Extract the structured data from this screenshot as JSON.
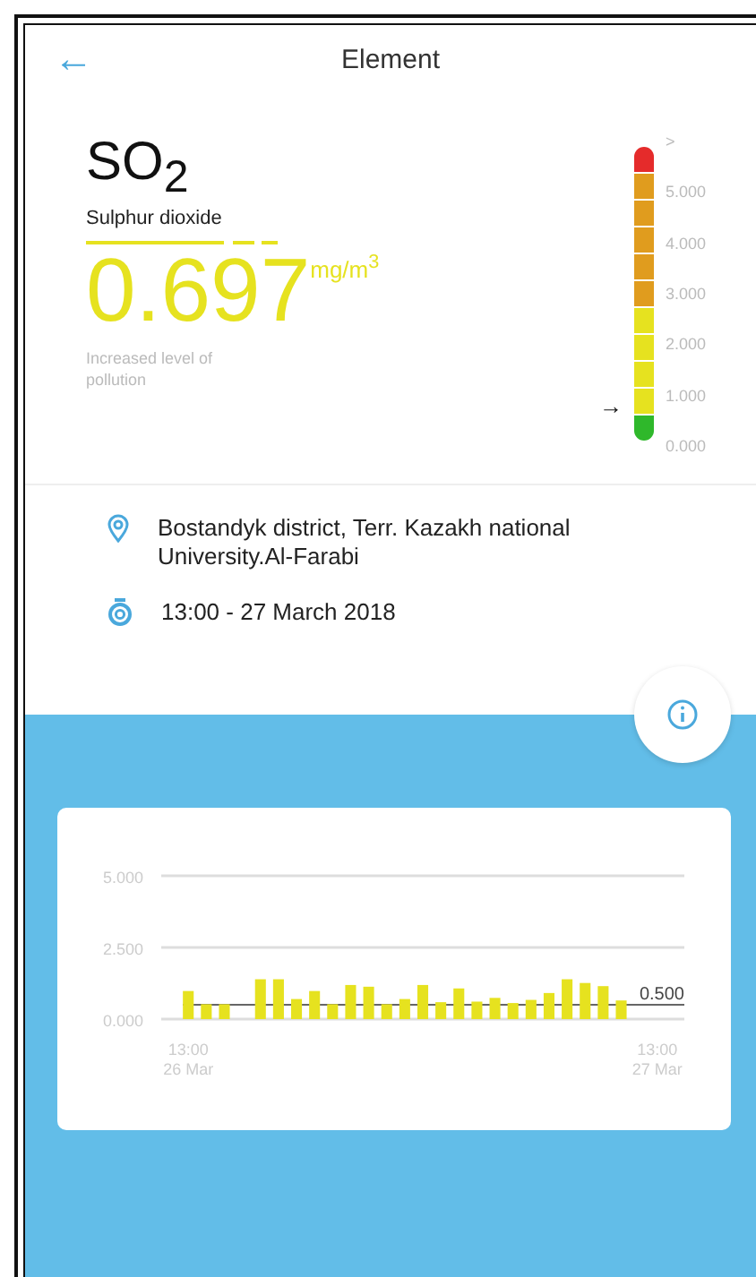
{
  "header": {
    "back": "←",
    "title": "Element"
  },
  "element": {
    "formula": "SO$_{2}$",
    "name": "Sulphur dioxide",
    "value": "0.697",
    "unit": "mg/m$^{3}$",
    "note": "Increased level of pollution"
  },
  "scale": {
    "labels": [
      ">",
      "5.000",
      "4.000",
      "3.000",
      "2.000",
      "1.000",
      "0.000"
    ],
    "pointer": "→",
    "segments": [
      {
        "color": "#e52b2b"
      },
      {
        "color": "#e09c1e"
      },
      {
        "color": "#e09c1e"
      },
      {
        "color": "#e09c1e"
      },
      {
        "color": "#e09c1e"
      },
      {
        "color": "#e09c1e"
      },
      {
        "color": "#e6e21f"
      },
      {
        "color": "#e6e21f"
      },
      {
        "color": "#e6e21f"
      },
      {
        "color": "#e6e21f"
      },
      {
        "color": "#2fb82b"
      }
    ]
  },
  "details": [
    {
      "kind": "location",
      "text": "Bostandyk district, Terr. Kazakh national University.Al-Farabi"
    },
    {
      "kind": "time",
      "text": "13:00 - 27 March 2018"
    }
  ],
  "chart": {
    "chart_data": {
      "type": "bar",
      "categories": [
        null,
        "13:00 26 Mar",
        null,
        null,
        null,
        null,
        null,
        null,
        null,
        null,
        null,
        null,
        null,
        null,
        null,
        null,
        null,
        null,
        null,
        null,
        null,
        null,
        null,
        null,
        null,
        null,
        null,
        "13:00 27 Mar",
        null
      ],
      "series": [
        {
          "color": "#e6e21f",
          "values": [
            null,
            0.98,
            0.52,
            0.52,
            null,
            1.39,
            1.39,
            0.7,
            0.98,
            0.52,
            1.19,
            1.13,
            0.52,
            0.7,
            1.19,
            0.59,
            1.07,
            0.61,
            0.74,
            0.56,
            0.67,
            0.91,
            1.39,
            1.26,
            1.15,
            0.65,
            null,
            null,
            null
          ]
        }
      ],
      "ylim": [
        0,
        5
      ],
      "yticks": [
        {
          "value": 0,
          "label": "0.000"
        },
        {
          "value": 2.5,
          "label": "2.500"
        },
        {
          "value": 5,
          "label": "5.000"
        }
      ],
      "ref_lines": [
        {
          "axis": "y",
          "value": 0.5,
          "label": "0.500"
        }
      ]
    }
  }
}
